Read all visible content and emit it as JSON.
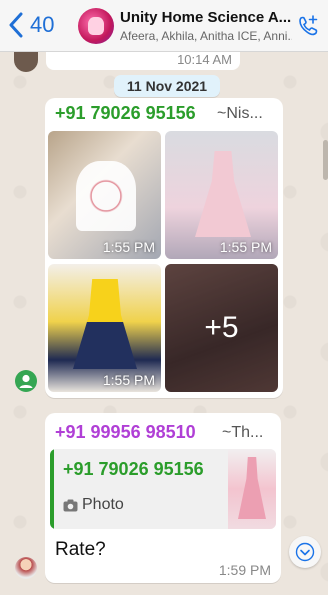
{
  "header": {
    "back_count": "40",
    "title": "Unity Home Science A...",
    "subtitle": "Afeera, Akhila, Anitha ICE, Anni..."
  },
  "top_message": {
    "time": "10:14 AM"
  },
  "date_divider": "11 Nov 2021",
  "message1": {
    "sender_phone": "+91 79026 95156",
    "sender_name": "~Nis...",
    "images": [
      {
        "time": "1:55 PM"
      },
      {
        "time": "1:55 PM"
      },
      {
        "time": "1:55 PM"
      },
      {
        "more": "+5"
      }
    ]
  },
  "message2": {
    "sender_phone": "+91 99956 98510",
    "sender_name": "~Th...",
    "quoted": {
      "sender_phone": "+91 79026 95156",
      "type": "Photo"
    },
    "text": "Rate?",
    "time": "1:59 PM"
  },
  "colors": {
    "accent": "#1a73e8",
    "sender_green": "#2b9d2b",
    "sender_purple": "#b03fd6"
  },
  "icons": [
    "chevron-left-icon",
    "add-call-icon",
    "camera-icon",
    "person-icon",
    "chevron-down-icon"
  ]
}
